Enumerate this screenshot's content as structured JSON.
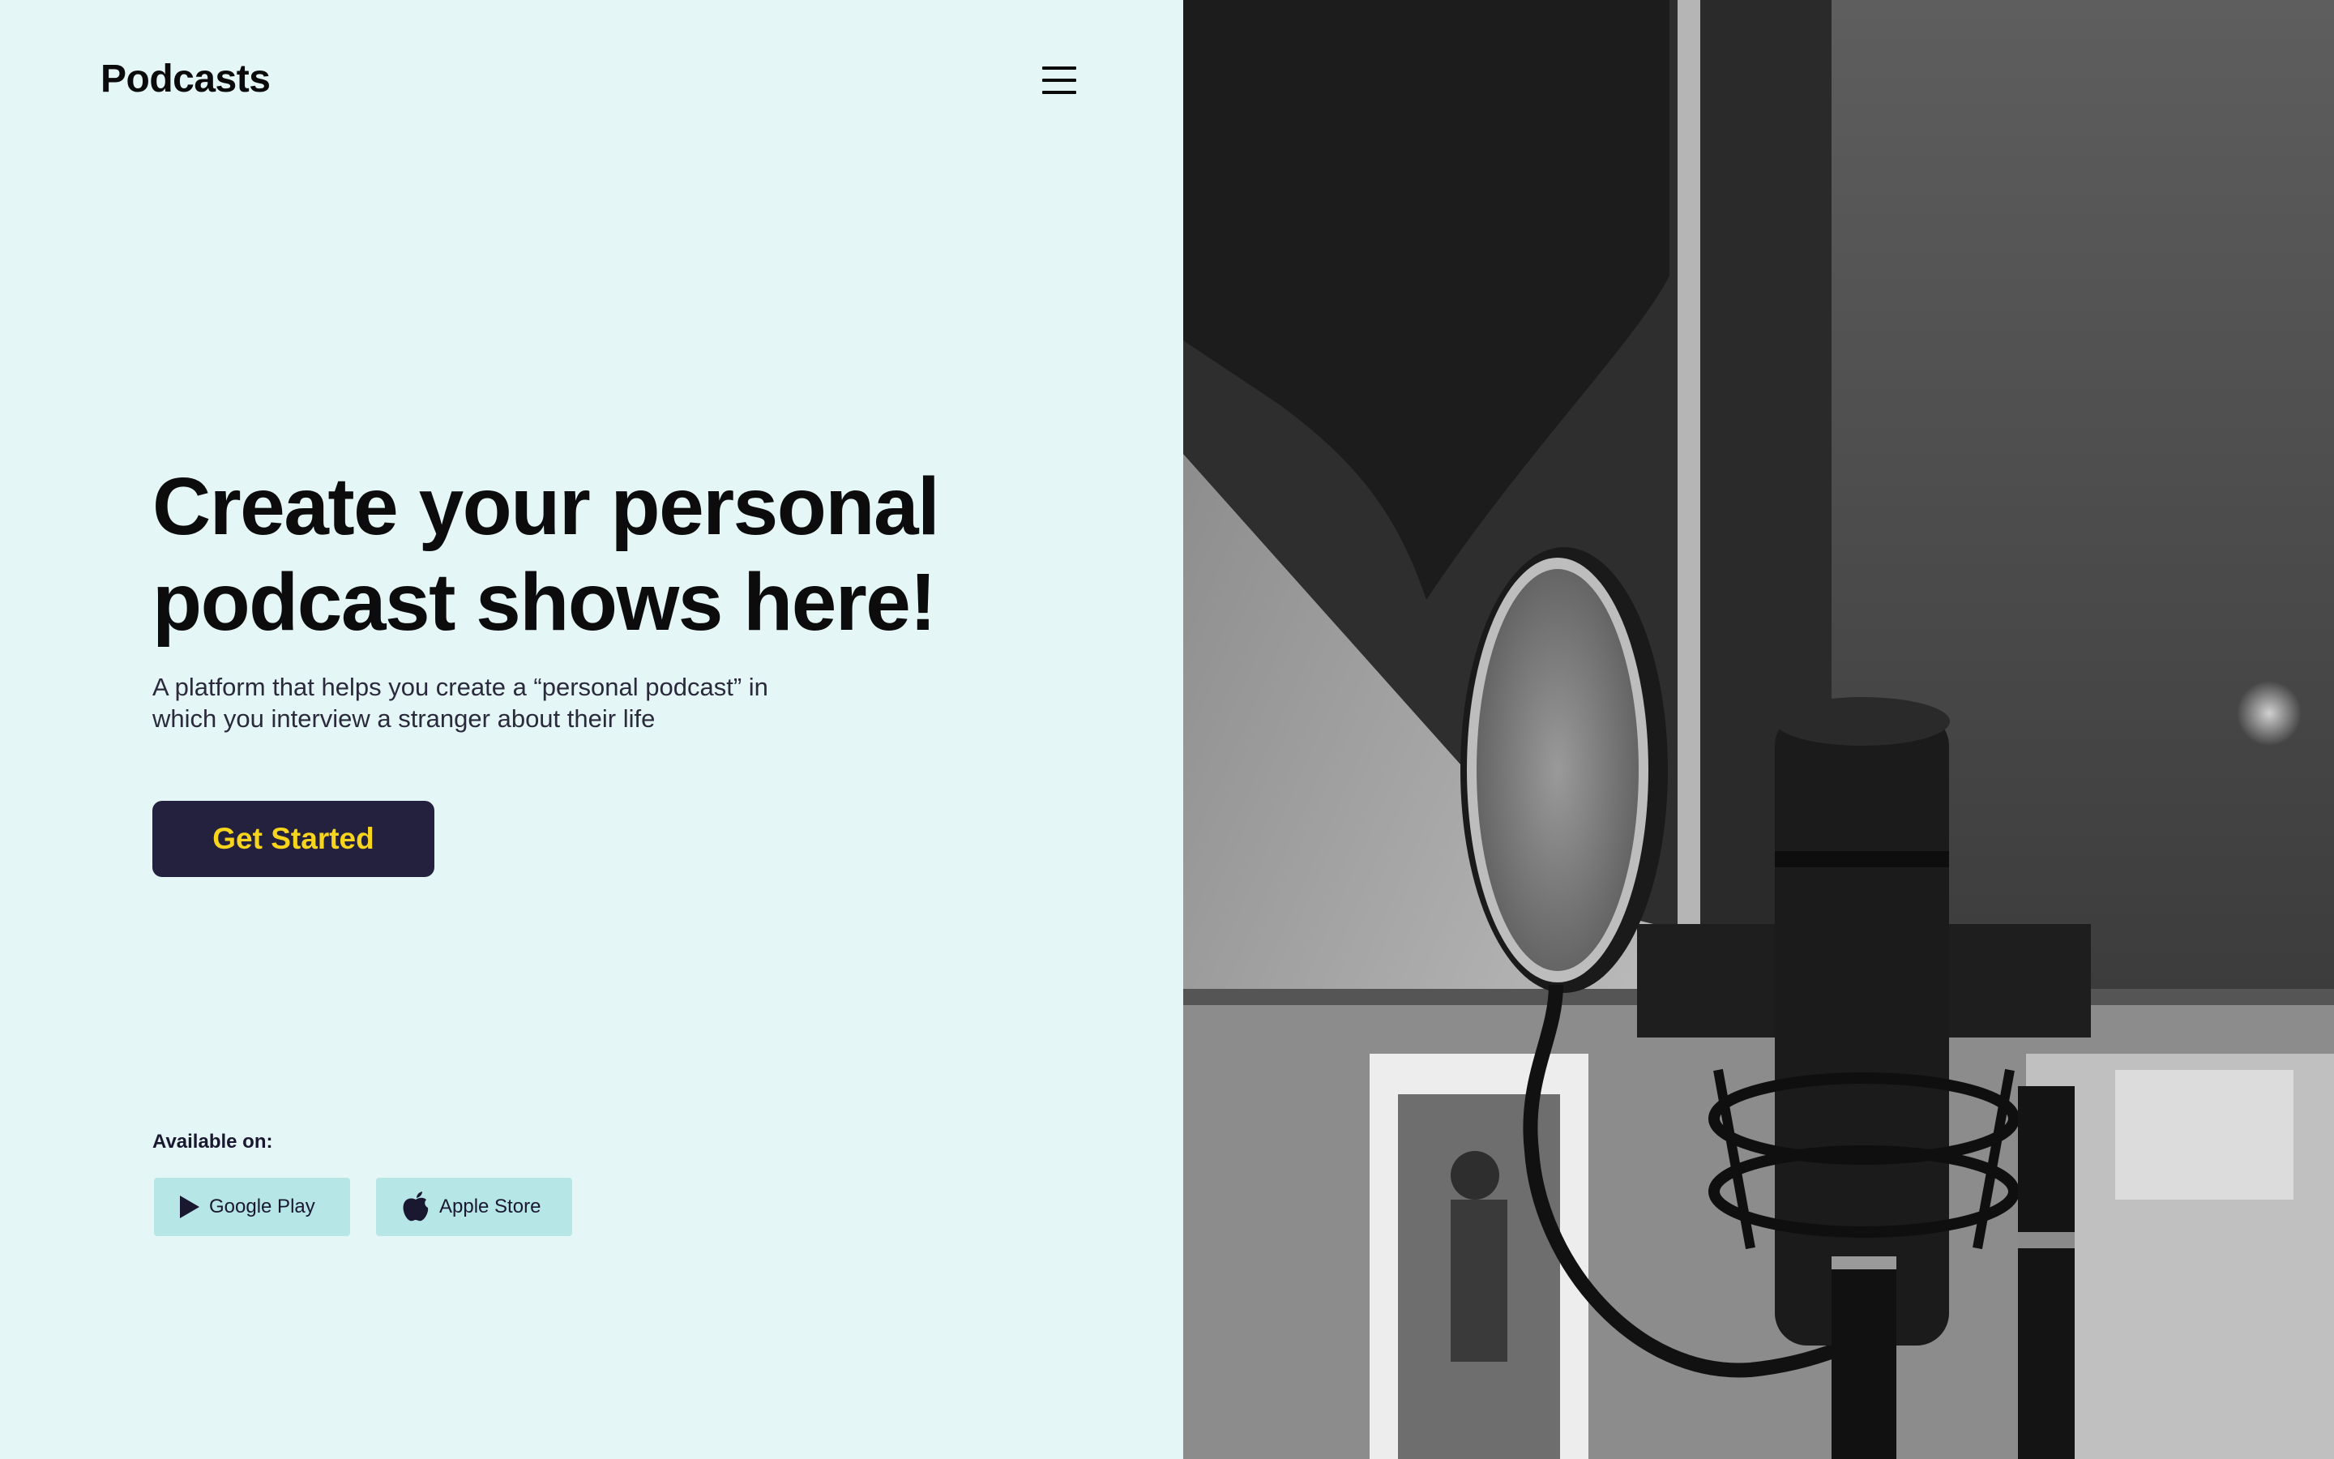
{
  "header": {
    "logo": "Podcasts",
    "menu_icon": "hamburger-menu-icon"
  },
  "hero": {
    "headline": "Create your personal\npodcast shows  here!",
    "subtitle": "A platform that helps you create a “personal podcast” in\nwhich you interview a stranger about their life",
    "cta_label": "Get Started"
  },
  "availability": {
    "label": "Available on:",
    "stores": [
      {
        "label": "Google Play",
        "icon": "play-triangle-icon"
      },
      {
        "label": "Apple Store",
        "icon": "apple-icon"
      }
    ]
  },
  "colors": {
    "background": "#e4f6f5",
    "cta_background": "#24213f",
    "cta_text": "#f7d51c",
    "store_button": "#b7e6e6"
  },
  "image": {
    "icon": "microphone-photo"
  }
}
